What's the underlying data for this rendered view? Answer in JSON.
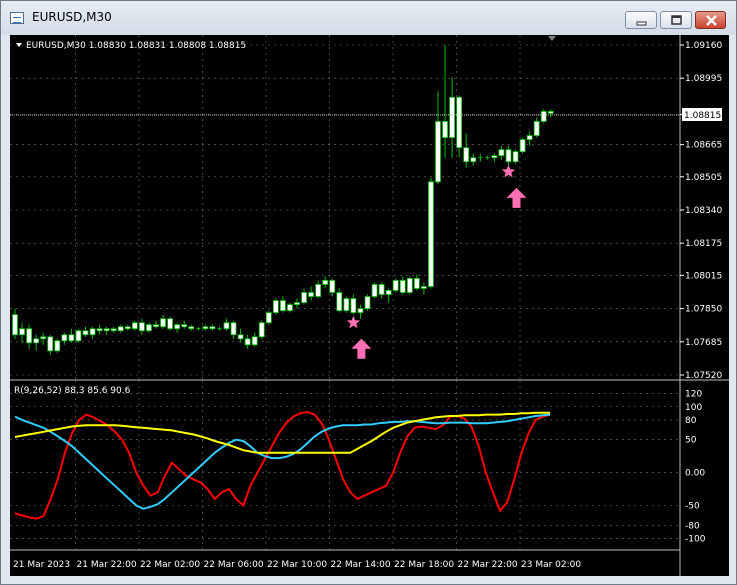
{
  "window": {
    "title": "EURUSD,M30"
  },
  "chart_data": {
    "type": "candlestick",
    "symbol": "EURUSD",
    "timeframe": "M30",
    "info_line": "EURUSD,M30  1.08830 1.08831 1.08808 1.08815",
    "ohlc": {
      "open": "1.08830",
      "high": "1.08831",
      "low": "1.08808",
      "close": "1.08815"
    },
    "current_price": 1.08815,
    "current_price_label": "1.08815",
    "price_ylim": [
      1.0752,
      1.0916
    ],
    "price_ticks": [
      "1.09160",
      "1.08995",
      "1.08815",
      "1.08665",
      "1.08505",
      "1.08340",
      "1.08175",
      "1.08015",
      "1.07850",
      "1.07685",
      "1.07520"
    ],
    "x_ticks": [
      "21 Mar 2023",
      "21 Mar 22:00",
      "22 Mar 02:00",
      "22 Mar 06:00",
      "22 Mar 10:00",
      "22 Mar 14:00",
      "22 Mar 18:00",
      "22 Mar 22:00",
      "23 Mar 02:00"
    ],
    "grid": true,
    "colors": {
      "background": "#000000",
      "up_body": "#ffffff",
      "down_body": "#ffffff",
      "wick": "#00c000",
      "grid": "#c0c0c0",
      "signal": "#ff6fb5"
    },
    "candles": [
      [
        1.0782,
        1.0785,
        1.077,
        1.0772
      ],
      [
        1.0772,
        1.0778,
        1.0768,
        1.0775
      ],
      [
        1.0775,
        1.0777,
        1.0765,
        1.0768
      ],
      [
        1.0768,
        1.0772,
        1.0764,
        1.077
      ],
      [
        1.077,
        1.0773,
        1.0767,
        1.0771
      ],
      [
        1.0771,
        1.0772,
        1.0762,
        1.0764
      ],
      [
        1.0764,
        1.077,
        1.0763,
        1.0769
      ],
      [
        1.0769,
        1.0773,
        1.0767,
        1.0772
      ],
      [
        1.0772,
        1.0775,
        1.0768,
        1.0769
      ],
      [
        1.0769,
        1.0775,
        1.0768,
        1.0774
      ],
      [
        1.0774,
        1.0776,
        1.0771,
        1.0772
      ],
      [
        1.0772,
        1.0776,
        1.077,
        1.0775
      ],
      [
        1.0775,
        1.0777,
        1.0772,
        1.0774
      ],
      [
        1.0774,
        1.0776,
        1.0772,
        1.0775
      ],
      [
        1.0775,
        1.0776,
        1.0773,
        1.0774
      ],
      [
        1.0774,
        1.0777,
        1.0773,
        1.0776
      ],
      [
        1.0776,
        1.0777,
        1.0774,
        1.0775
      ],
      [
        1.0775,
        1.0779,
        1.0774,
        1.0778
      ],
      [
        1.0778,
        1.078,
        1.0772,
        1.0774
      ],
      [
        1.0774,
        1.0778,
        1.0773,
        1.0777
      ],
      [
        1.0777,
        1.0779,
        1.0775,
        1.0776
      ],
      [
        1.0776,
        1.0782,
        1.0775,
        1.078
      ],
      [
        1.078,
        1.0781,
        1.0774,
        1.0775
      ],
      [
        1.0775,
        1.0778,
        1.0773,
        1.0777
      ],
      [
        1.0777,
        1.0779,
        1.0775,
        1.0776
      ],
      [
        1.0776,
        1.0777,
        1.0774,
        1.0775
      ],
      [
        1.0775,
        1.0776,
        1.0774,
        1.0775
      ],
      [
        1.0775,
        1.0777,
        1.0774,
        1.0776
      ],
      [
        1.0776,
        1.0777,
        1.0774,
        1.0775
      ],
      [
        1.0775,
        1.0776,
        1.0774,
        1.0775
      ],
      [
        1.0775,
        1.078,
        1.0774,
        1.0778
      ],
      [
        1.0778,
        1.0779,
        1.077,
        1.0772
      ],
      [
        1.0772,
        1.0775,
        1.0768,
        1.077
      ],
      [
        1.077,
        1.0772,
        1.0765,
        1.0767
      ],
      [
        1.0767,
        1.0773,
        1.0766,
        1.0771
      ],
      [
        1.0771,
        1.0779,
        1.077,
        1.0778
      ],
      [
        1.0778,
        1.0784,
        1.0777,
        1.0783
      ],
      [
        1.0783,
        1.079,
        1.0782,
        1.0789
      ],
      [
        1.0789,
        1.0791,
        1.0783,
        1.0784
      ],
      [
        1.0784,
        1.0788,
        1.0783,
        1.0787
      ],
      [
        1.0787,
        1.079,
        1.0785,
        1.0788
      ],
      [
        1.0788,
        1.0795,
        1.0787,
        1.0793
      ],
      [
        1.0793,
        1.0796,
        1.0789,
        1.0791
      ],
      [
        1.0791,
        1.0799,
        1.079,
        1.0797
      ],
      [
        1.0797,
        1.0801,
        1.0795,
        1.0799
      ],
      [
        1.0799,
        1.08,
        1.0791,
        1.0793
      ],
      [
        1.0793,
        1.0795,
        1.0783,
        1.0784
      ],
      [
        1.0784,
        1.0791,
        1.0783,
        1.079
      ],
      [
        1.079,
        1.0792,
        1.0782,
        1.0783
      ],
      [
        1.0783,
        1.0787,
        1.078,
        1.0785
      ],
      [
        1.0785,
        1.0792,
        1.0784,
        1.0791
      ],
      [
        1.0791,
        1.0798,
        1.079,
        1.0797
      ],
      [
        1.0797,
        1.0798,
        1.079,
        1.0792
      ],
      [
        1.0792,
        1.0795,
        1.0788,
        1.0794
      ],
      [
        1.0794,
        1.08,
        1.0793,
        1.0799
      ],
      [
        1.0799,
        1.0801,
        1.0792,
        1.0793
      ],
      [
        1.0793,
        1.0801,
        1.0792,
        1.08
      ],
      [
        1.08,
        1.0802,
        1.0794,
        1.0795
      ],
      [
        1.0795,
        1.0798,
        1.0792,
        1.0796
      ],
      [
        1.0796,
        1.085,
        1.0795,
        1.0848
      ],
      [
        1.0848,
        1.0893,
        1.0847,
        1.0878
      ],
      [
        1.0878,
        1.0916,
        1.086,
        1.087
      ],
      [
        1.087,
        1.09,
        1.086,
        1.089
      ],
      [
        1.089,
        1.0891,
        1.086,
        1.0865
      ],
      [
        1.0865,
        1.0872,
        1.0855,
        1.0858
      ],
      [
        1.0858,
        1.0862,
        1.0856,
        1.086
      ],
      [
        1.086,
        1.0862,
        1.0858,
        1.086
      ],
      [
        1.086,
        1.0861,
        1.0859,
        1.086
      ],
      [
        1.086,
        1.0862,
        1.0858,
        1.0861
      ],
      [
        1.0861,
        1.0866,
        1.0859,
        1.0864
      ],
      [
        1.0864,
        1.0866,
        1.0856,
        1.0858
      ],
      [
        1.0858,
        1.0864,
        1.0857,
        1.0863
      ],
      [
        1.0863,
        1.087,
        1.0862,
        1.0869
      ],
      [
        1.0869,
        1.0873,
        1.0866,
        1.0871
      ],
      [
        1.0871,
        1.088,
        1.087,
        1.0878
      ],
      [
        1.0878,
        1.0884,
        1.0877,
        1.0883
      ],
      [
        1.0883,
        1.0884,
        1.088,
        1.0882
      ]
    ],
    "signals": [
      {
        "bar_index": 48,
        "price": 1.0778,
        "arrow_price": 1.077
      },
      {
        "bar_index": 70,
        "price": 1.0853,
        "arrow_price": 1.0845
      }
    ],
    "indicator": {
      "label": "R(9,26,52) 88.3 85.6 90.6",
      "ylim": [
        -110,
        130
      ],
      "ticks": [
        "120",
        "100",
        "80",
        "50",
        "0.00",
        "-50",
        "-80",
        "-100"
      ],
      "series": [
        {
          "color": "#ff0000",
          "values": [
            -62,
            -65,
            -68,
            -70,
            -66,
            -40,
            -10,
            30,
            60,
            80,
            88,
            84,
            78,
            72,
            62,
            50,
            30,
            0,
            -20,
            -35,
            -30,
            -5,
            15,
            5,
            -5,
            -10,
            -15,
            -25,
            -40,
            -30,
            -25,
            -40,
            -50,
            -20,
            0,
            20,
            40,
            60,
            75,
            85,
            90,
            92,
            88,
            75,
            50,
            20,
            -10,
            -30,
            -40,
            -35,
            -30,
            -25,
            -20,
            0,
            30,
            55,
            68,
            70,
            68,
            66,
            72,
            85,
            86,
            82,
            70,
            40,
            0,
            -30,
            -58,
            -45,
            -10,
            30,
            60,
            80,
            85,
            88
          ]
        },
        {
          "color": "#33ccff",
          "values": [
            85,
            80,
            76,
            72,
            68,
            62,
            55,
            48,
            40,
            30,
            20,
            10,
            0,
            -10,
            -20,
            -30,
            -40,
            -50,
            -55,
            -52,
            -48,
            -40,
            -30,
            -20,
            -10,
            0,
            10,
            20,
            30,
            38,
            45,
            50,
            48,
            40,
            30,
            25,
            22,
            22,
            24,
            28,
            35,
            45,
            55,
            62,
            67,
            70,
            72,
            72,
            72,
            73,
            73,
            75,
            76,
            77,
            77,
            78,
            78,
            77,
            76,
            75,
            75,
            76,
            76,
            76,
            75,
            75,
            75,
            76,
            77,
            78,
            80,
            82,
            84,
            86,
            87,
            88
          ]
        },
        {
          "color": "#ffff00",
          "values": [
            54,
            56,
            58,
            60,
            62,
            64,
            66,
            68,
            70,
            71,
            72,
            72,
            72,
            72,
            72,
            71,
            70,
            69,
            68,
            67,
            66,
            65,
            64,
            62,
            60,
            58,
            55,
            52,
            48,
            45,
            42,
            38,
            34,
            32,
            30,
            30,
            30,
            30,
            30,
            30,
            30,
            30,
            30,
            30,
            30,
            30,
            30,
            30,
            36,
            42,
            48,
            55,
            62,
            68,
            72,
            76,
            78,
            80,
            82,
            84,
            85,
            86,
            86,
            87,
            87,
            87,
            88,
            88,
            88,
            89,
            89,
            90,
            90,
            91,
            91,
            91
          ]
        }
      ]
    }
  }
}
